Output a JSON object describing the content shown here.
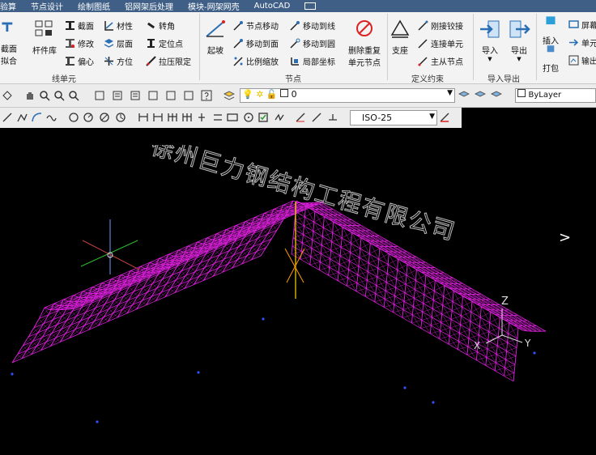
{
  "menubar": {
    "items": [
      "验算",
      "节点设计",
      "绘制图纸",
      "铝网架后处理",
      "模块-网架网壳",
      "AutoCAD"
    ]
  },
  "ribbon": {
    "groups": {
      "line_unit": {
        "label": "线单元",
        "big_left_1": "截面",
        "big_left_2": "拟合",
        "member_lib": "杆件库",
        "section": "截面",
        "modify": "修改",
        "eccentric": "偏心",
        "material": "材性",
        "layer": "层面",
        "orientation": "方位",
        "rotate": "转角",
        "locate_point": "定位点",
        "tension_limit": "拉压限定"
      },
      "node": {
        "label": "节点",
        "slope": "起坡",
        "node_move": "节点移动",
        "move_to_surface": "移动到面",
        "scale": "比例缩放",
        "move_to_line": "移动到线",
        "move_to_circle": "移动到圆",
        "local_coord": "局部坐标",
        "del_dup_1": "删除重复",
        "del_dup_2": "单元节点"
      },
      "constraint": {
        "label": "定义约束",
        "support": "支座",
        "rigid_hinge": "刚接铰接",
        "connect_unit": "连接单元",
        "master_slave": "主从节点"
      },
      "io": {
        "label": "导入导出",
        "import": "导入",
        "export": "导出"
      },
      "extra": {
        "insert": "插入",
        "pack": "打包",
        "screen": "屏幕",
        "unit": "单元",
        "output": "输出"
      }
    }
  },
  "toolbar": {
    "layer_value": "0",
    "dimstyle_value": "ISO-25",
    "color_value": "ByLayer"
  },
  "viewport": {
    "watermark": "徐州巨力钢结构工程有限公司",
    "axis_label_z": "Z",
    "axis_label_x": "X",
    "axis_label_y": "Y",
    "mesh_color": "#e020e0",
    "nav_arrow": ">"
  }
}
